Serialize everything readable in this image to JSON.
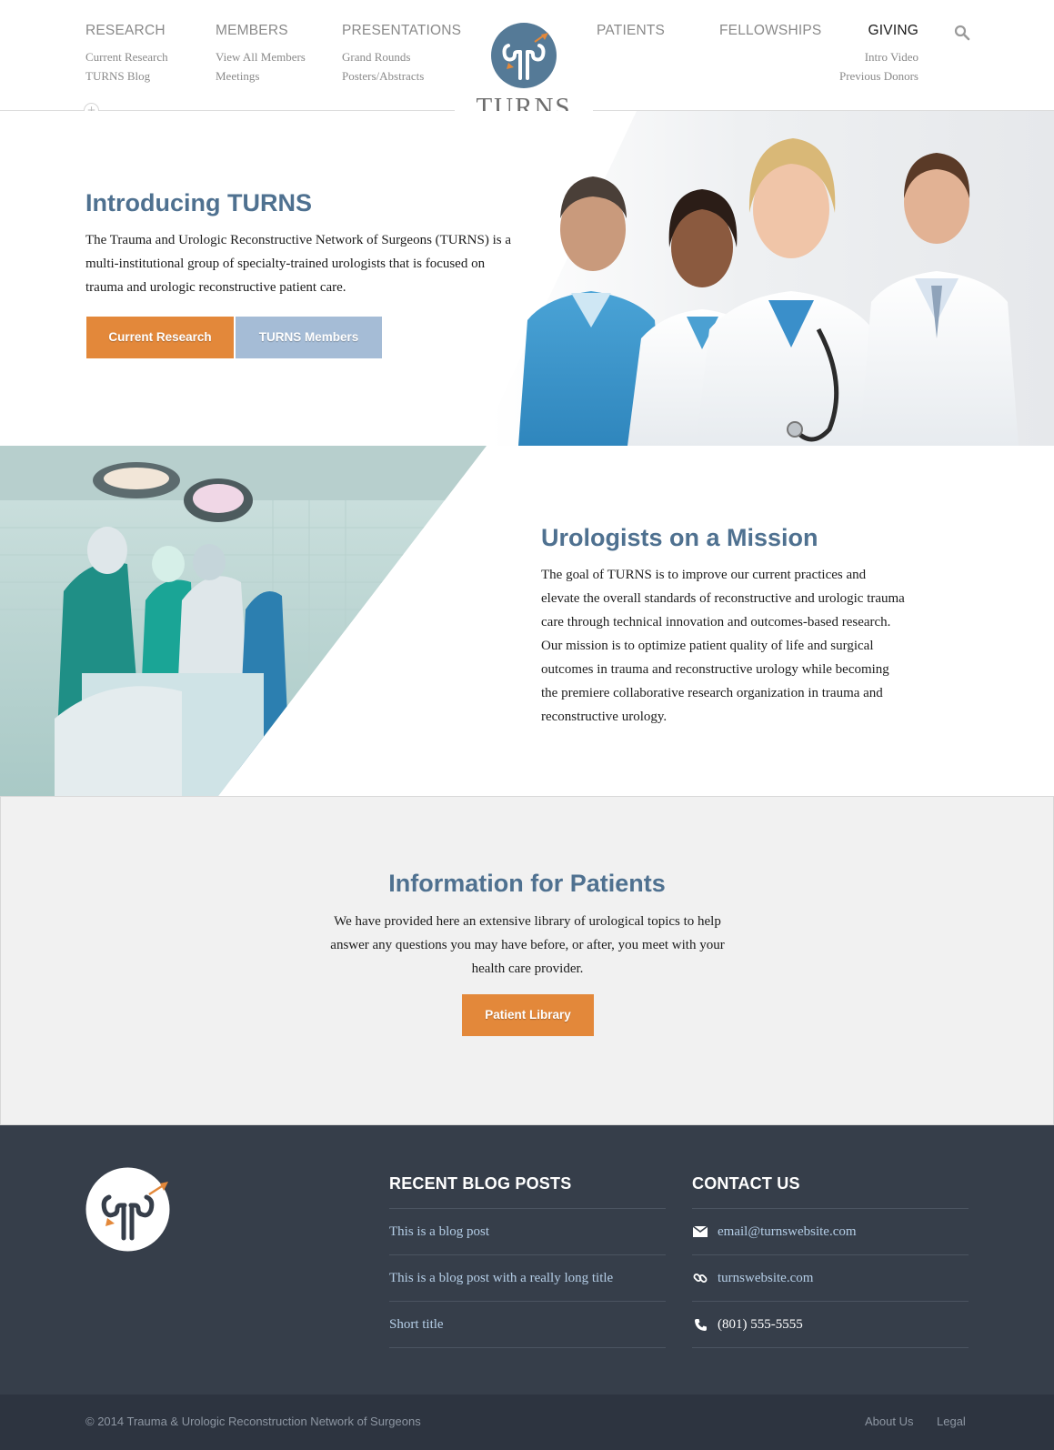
{
  "nav": {
    "left": [
      {
        "label": "RESEARCH",
        "subs": [
          "Current Research",
          "TURNS Blog"
        ]
      },
      {
        "label": "MEMBERS",
        "subs": [
          "View All Members",
          "Meetings"
        ]
      },
      {
        "label": "PRESENTATIONS",
        "subs": [
          "Grand Rounds",
          "Posters/Abstracts"
        ]
      }
    ],
    "right": [
      {
        "label": "PATIENTS"
      },
      {
        "label": "FELLOWSHIPS"
      },
      {
        "label": "GIVING",
        "subs": [
          "Intro Video",
          "Previous Donors"
        ]
      }
    ],
    "active": "GIVING",
    "search_icon": "search-icon"
  },
  "logo": {
    "word": "TURNS",
    "icon": "kidney-logo-icon"
  },
  "colors": {
    "accent_blue": "#4f7190",
    "orange": "#e3883a",
    "light_blue": "#a5bcd6",
    "footer_bg": "#363e4a",
    "bottom_bg": "#2d3440",
    "link_blue": "#b4cde6"
  },
  "hero": {
    "title": "Introducing TURNS",
    "text": "The Trauma and Urologic Reconstructive Network of Surgeons (TURNS) is a multi-institutional group of specialty-trained urologists that is focused on trauma and urologic reconstructive patient care.",
    "button_primary": "Current Research",
    "button_secondary": "TURNS Members"
  },
  "mission": {
    "title": "Urologists on a Mission",
    "text": "The goal of TURNS is to improve our current practices and elevate the overall standards of reconstructive and urologic trauma care through technical innovation and outcomes-based research. Our mission is to optimize patient quality of life and surgical outcomes in trauma and reconstructive urology while becoming the premiere collaborative research organization in trauma and reconstructive urology."
  },
  "patients": {
    "title": "Information for Patients",
    "text": "We have provided here an extensive library of urological topics to help answer any questions you may have before, or after, you meet with your health care provider.",
    "button": "Patient Library"
  },
  "footer": {
    "blog_heading": "RECENT BLOG POSTS",
    "blog_posts": [
      "This is a blog post",
      "This is a blog post with a really long title",
      "Short title"
    ],
    "contact_heading": "CONTACT US",
    "email": "email@turnswebsite.com",
    "website": "turnswebsite.com",
    "phone": "(801) 555-5555",
    "copyright": "© 2014 Trauma & Urologic Reconstruction Network of Surgeons",
    "links": [
      "About Us",
      "Legal"
    ]
  }
}
